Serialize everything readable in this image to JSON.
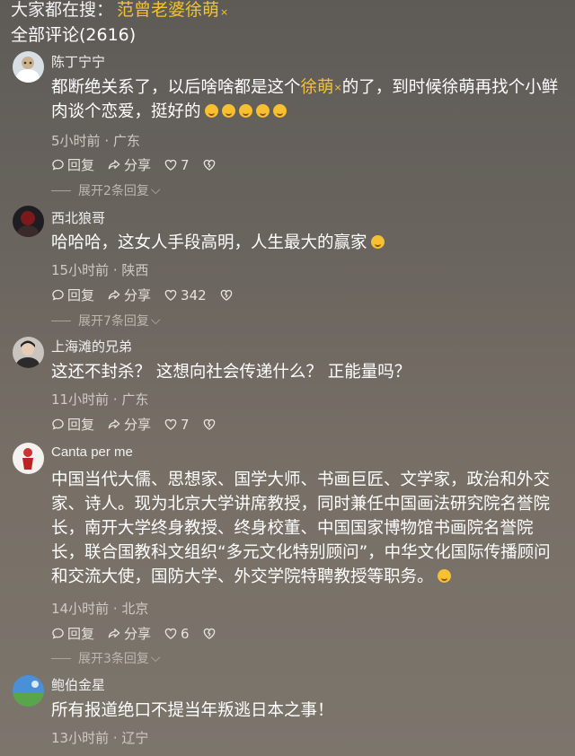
{
  "hot_search": {
    "prefix": "大家都在搜：",
    "keyword": "范曾老婆徐萌",
    "search_icon": "search-icon"
  },
  "total_comments": "全部评论(2616)",
  "actions_labels": {
    "reply": "回复",
    "share": "分享"
  },
  "comments": [
    {
      "user": "陈丁宁宁",
      "text_parts": [
        "都断绝关系了，以后啥啥都是这个",
        "徐萌",
        "的了，到时候徐萌再找个小鲜肉谈个恋爱，挺好的"
      ],
      "emoji_count": 5,
      "emoji": "grin-emoji",
      "time": "5小时前",
      "location": "广东",
      "likes": "7",
      "expand": "展开2条回复"
    },
    {
      "user": "西北狼哥",
      "text": "哈哈哈，这女人手段高明，人生最大的赢家",
      "emoji": "laugh-cry-emoji",
      "time": "15小时前",
      "location": "陕西",
      "likes": "342",
      "expand": "展开7条回复"
    },
    {
      "user": "上海滩的兄弟",
      "text": "这还不封杀？  这想向社会传递什么？ 正能量吗？",
      "time": "11小时前",
      "location": "广东",
      "likes": "7"
    },
    {
      "user": "Canta per me",
      "text": "中国当代大儒、思想家、国学大师、书画巨匠、文学家，政治和外交家、诗人。现为北京大学讲席教授，同时兼任中国画法研究院名誉院长，南开大学终身教授、终身校董、中国国家博物馆书画院名誉院长，联合国教科文组织“多元文化特别顾问”，中华文化国际传播顾问和交流大使，国防大学、外交学院特聘教授等职务。",
      "emoji": "laugh-cry-emoji",
      "time": "14小时前",
      "location": "北京",
      "likes": "6",
      "expand": "展开3条回复"
    },
    {
      "user": "鲍伯金星",
      "text": "所有报道绝口不提当年叛逃日本之事！",
      "time": "13小时前",
      "location": "辽宁"
    }
  ],
  "colors": {
    "keyword": "#f2c232",
    "text": "#ffffff",
    "meta": "#cfcac4"
  }
}
